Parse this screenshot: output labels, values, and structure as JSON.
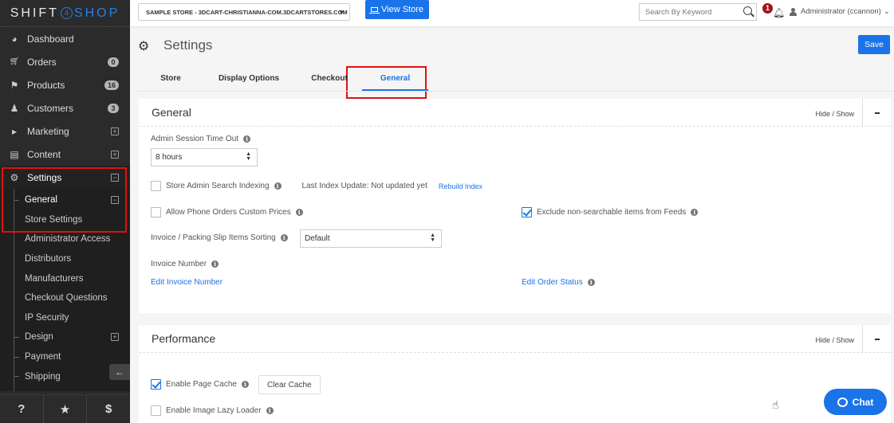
{
  "brand": {
    "left": "SHIFT",
    "mid": "4",
    "right": "SHOP"
  },
  "sidebar": {
    "items": [
      {
        "label": "Dashboard",
        "icon": "dashboard-icon",
        "glyph": "◕"
      },
      {
        "label": "Orders",
        "icon": "cart-icon",
        "glyph": "🛒",
        "badge": "0"
      },
      {
        "label": "Products",
        "icon": "tag-icon",
        "glyph": "🏷",
        "badge": "16"
      },
      {
        "label": "Customers",
        "icon": "user-icon",
        "glyph": "👤",
        "badge": "3"
      },
      {
        "label": "Marketing",
        "icon": "megaphone-icon",
        "glyph": "📣",
        "expand": "+"
      },
      {
        "label": "Content",
        "icon": "document-icon",
        "glyph": "📄",
        "expand": "+"
      },
      {
        "label": "Settings",
        "icon": "gears-icon",
        "glyph": "⚙",
        "expand": "−"
      }
    ],
    "settings_sub": [
      {
        "label": "General",
        "expand": "−"
      },
      {
        "label": "Store Settings"
      },
      {
        "label": "Administrator Access"
      },
      {
        "label": "Distributors"
      },
      {
        "label": "Manufacturers"
      },
      {
        "label": "Checkout Questions"
      },
      {
        "label": "IP Security"
      },
      {
        "label": "Design",
        "expand": "+"
      },
      {
        "label": "Payment"
      },
      {
        "label": "Shipping"
      }
    ],
    "collapse_glyph": "←",
    "footer": {
      "help": "?",
      "favorites": "★",
      "billing": "$"
    }
  },
  "topbar": {
    "store_selector": "SAMPLE STORE - 3DCART-CHRISTIANNA-COM.3DCARTSTORES.COM",
    "store_caret": "▼",
    "view_store": "View Store",
    "search_placeholder": "Search By Keyword",
    "notification_count": "1",
    "bell": "🔔",
    "user": "Administrator (ccannon)",
    "user_caret": "⌄"
  },
  "page": {
    "gears": "⚙",
    "title": "Settings",
    "save": "Save",
    "tabs": [
      "Store",
      "Display Options",
      "Checkout",
      "General"
    ],
    "active_tab": "General"
  },
  "general_panel": {
    "title": "General",
    "hide_show": "Hide / Show",
    "admin_session_label": "Admin Session Time Out",
    "admin_session_value": "8 hours",
    "search_indexing_label": "Store Admin Search Indexing",
    "search_indexing_checked": false,
    "last_index_update": "Last Index Update: Not updated yet",
    "rebuild_index": "Rebuild Index",
    "phone_orders_label": "Allow Phone Orders Custom Prices",
    "phone_orders_checked": false,
    "exclude_feeds_label": "Exclude non-searchable items from Feeds",
    "exclude_feeds_checked": true,
    "invoice_sorting_label": "Invoice / Packing Slip Items Sorting",
    "invoice_sorting_value": "Default",
    "invoice_number_label": "Invoice Number",
    "edit_invoice_number": "Edit Invoice Number",
    "edit_order_status": "Edit Order Status"
  },
  "performance_panel": {
    "title": "Performance",
    "hide_show": "Hide / Show",
    "page_cache_label": "Enable Page Cache",
    "page_cache_checked": true,
    "clear_cache": "Clear Cache",
    "lazy_loader_label": "Enable Image Lazy Loader",
    "lazy_loader_checked": false
  },
  "chat": {
    "label": "Chat"
  },
  "info_glyph": "i",
  "select_arrows": "▲▼",
  "colors": {
    "accent": "#1a73e8",
    "sidebar_bg": "#2b2b2b",
    "highlight": "#e01010",
    "notif": "#a3121a"
  }
}
